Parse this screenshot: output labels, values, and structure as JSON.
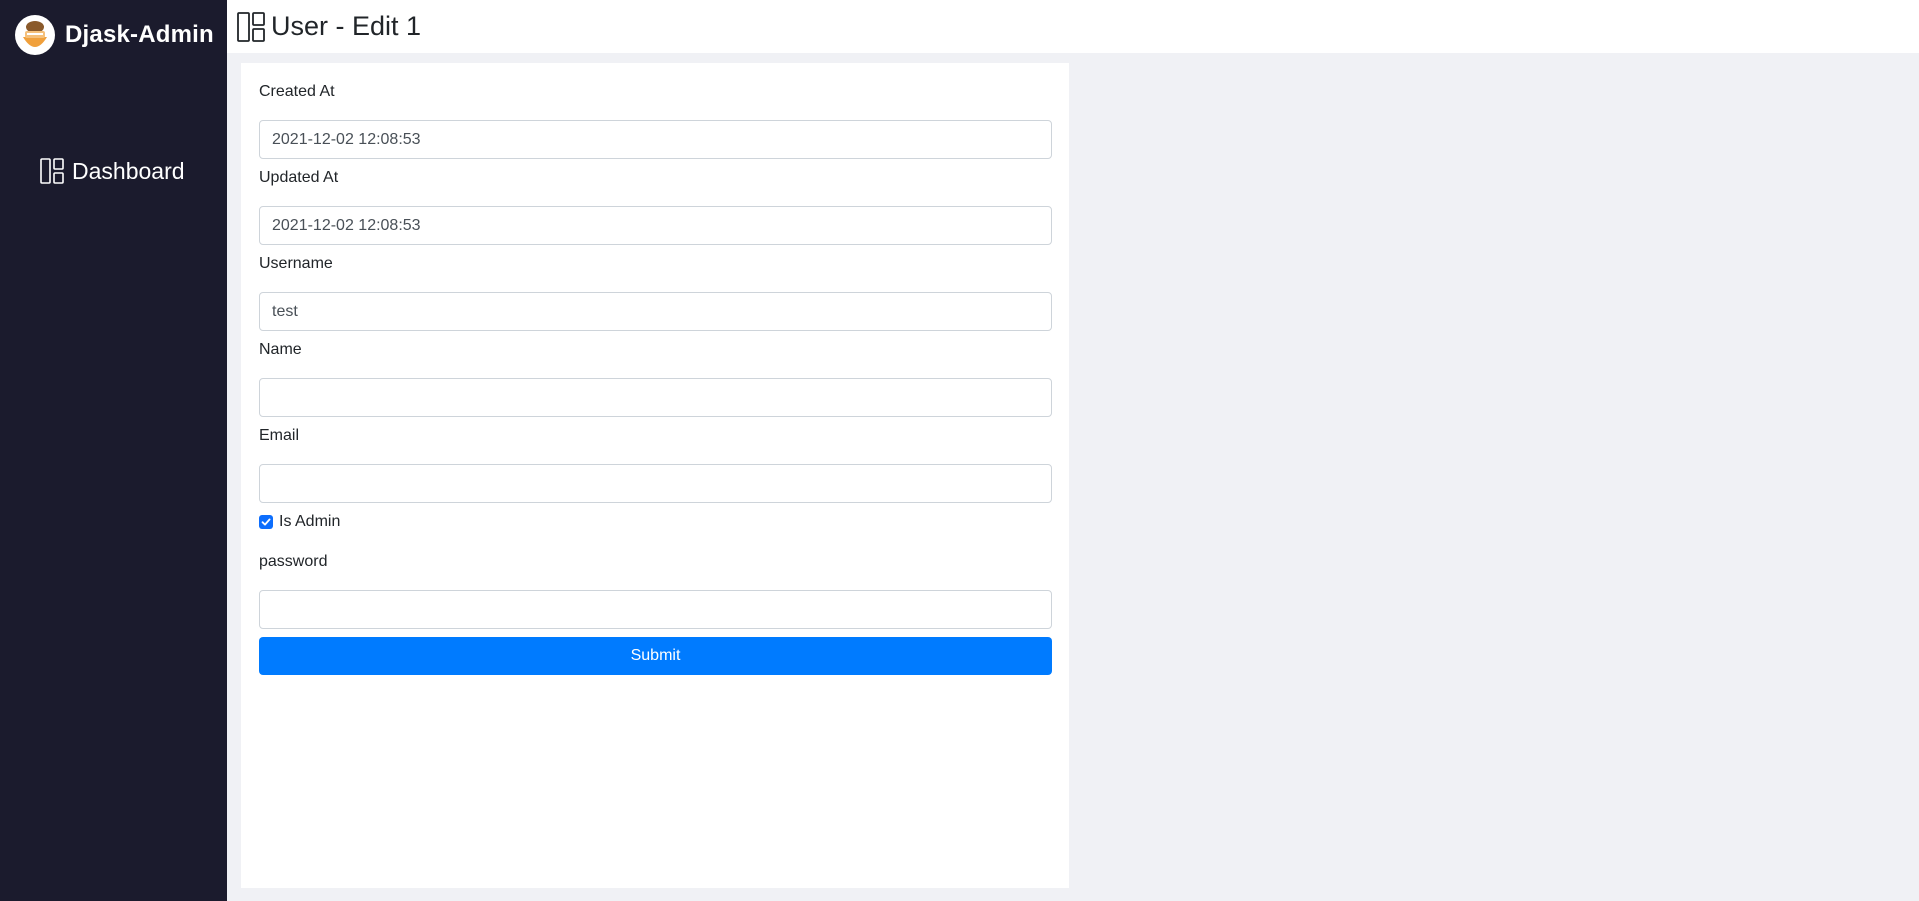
{
  "app": {
    "brand_title": "Djask-Admin"
  },
  "sidebar": {
    "items": [
      {
        "label": "Dashboard",
        "icon": "dashboard-icon"
      }
    ]
  },
  "header": {
    "title": "User - Edit 1",
    "icon": "dashboard-icon"
  },
  "form": {
    "created_at": {
      "label": "Created At",
      "value": "2021-12-02 12:08:53"
    },
    "updated_at": {
      "label": "Updated At",
      "value": "2021-12-02 12:08:53"
    },
    "username": {
      "label": "Username",
      "value": "test"
    },
    "name": {
      "label": "Name",
      "value": ""
    },
    "email": {
      "label": "Email",
      "value": ""
    },
    "is_admin": {
      "label": "Is Admin",
      "checked": true
    },
    "password": {
      "label": "password",
      "value": ""
    },
    "submit_label": "Submit"
  },
  "colors": {
    "sidebar_bg": "#1b1b2d",
    "page_bg": "#f0f1f5",
    "accent": "#007bff",
    "checkbox": "#0d6efd"
  }
}
